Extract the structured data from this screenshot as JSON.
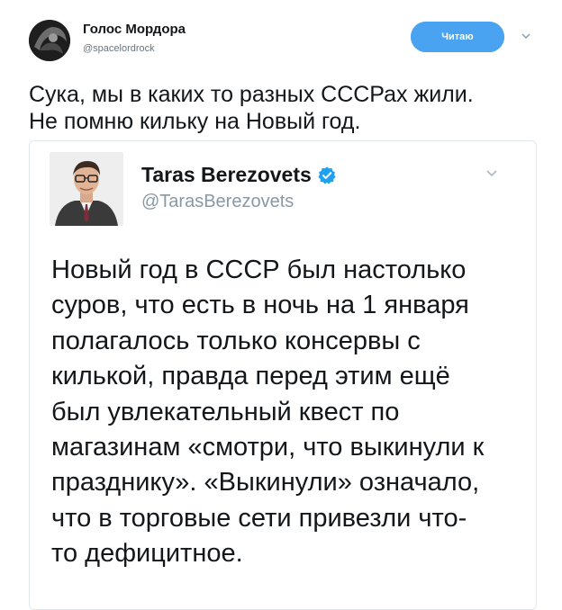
{
  "tweet": {
    "author": {
      "name": "Голос Мордора",
      "handle": "@spacelordrock"
    },
    "follow_label": "Читаю",
    "text_lines": [
      "Сука, мы в каких то разных СССРах жили.",
      "Не помню кильку на Новый год."
    ]
  },
  "quoted": {
    "name": "Taras Berezovets",
    "handle": "@TarasBerezovets",
    "text_lines": [
      "Новый год в СССР был настолько",
      "суров, что есть в ночь на 1 января",
      "полагалось только консервы с",
      "килькой, правда перед этим ещё",
      "был увлекательный квест по",
      "магазинам «смотри, что выкинули к",
      "празднику». «Выкинули» означало,",
      "что в торговые сети привезли что-",
      "то дефицитное."
    ]
  },
  "colors": {
    "follow_button": "#4aa3f0",
    "verified_badge": "#1da1f2",
    "handle_text": "#657786",
    "card_border": "#e1e8ed"
  },
  "icons": {
    "menu": "chevron-down-icon",
    "verified": "verified-badge-icon"
  }
}
